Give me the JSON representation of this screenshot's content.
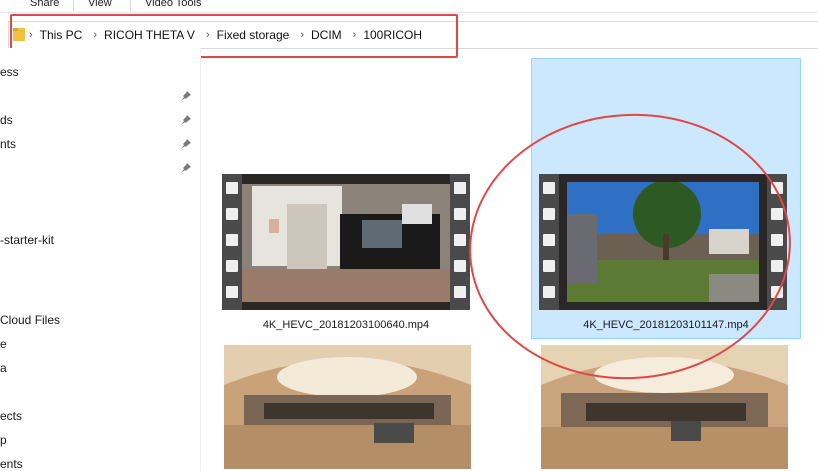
{
  "ribbon": {
    "tabs": [
      "Share",
      "View",
      "Video Tools"
    ]
  },
  "address_bar": {
    "breadcrumbs": [
      "This PC",
      "RICOH THETA V",
      "Fixed storage",
      "DCIM",
      "100RICOH"
    ]
  },
  "nav_pane": {
    "items": [
      "ess",
      "ds",
      "nts",
      "-starter-kit",
      "Cloud Files",
      "e",
      "a",
      "ects",
      "p",
      "ents"
    ]
  },
  "files": [
    {
      "name": "4K_HEVC_20181203100640.mp4",
      "selected": false,
      "type": "video"
    },
    {
      "name": "4K_HEVC_20181203101147.mp4",
      "selected": true,
      "type": "video"
    },
    {
      "name": "",
      "type": "image"
    },
    {
      "name": "",
      "type": "image"
    }
  ],
  "colors": {
    "selection": "#cce8ff",
    "selection_border": "#99d1ff",
    "annotation": "#e04848"
  }
}
